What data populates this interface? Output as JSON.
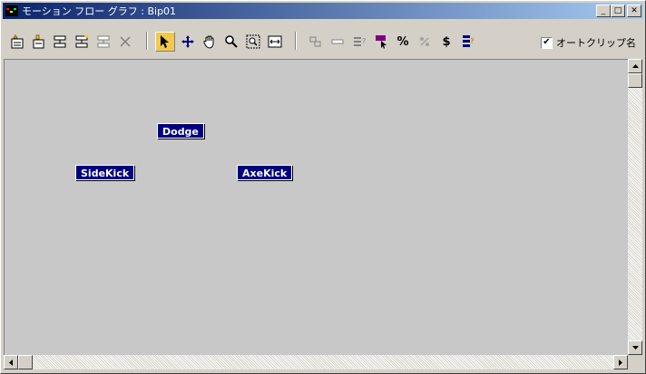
{
  "window": {
    "title": "モーション フロー グラフ : Bip01"
  },
  "title_controls": {
    "minimize": "_",
    "maximize": "□",
    "close": "✕"
  },
  "toolbar": {
    "tools_left": [
      {
        "name": "create-script-icon"
      },
      {
        "name": "open-script-icon"
      },
      {
        "name": "show-graph-icon"
      },
      {
        "name": "add-clip-icon"
      },
      {
        "name": "add-transition-icon"
      },
      {
        "name": "delete-icon"
      }
    ],
    "tools_mid": [
      {
        "name": "select-tool-icon",
        "active": true
      },
      {
        "name": "move-tool-icon"
      },
      {
        "name": "pan-hand-icon"
      },
      {
        "name": "zoom-icon"
      },
      {
        "name": "zoom-region-icon"
      },
      {
        "name": "zoom-extents-icon"
      }
    ],
    "tools_right": [
      {
        "name": "random-path-icon"
      },
      {
        "name": "clip-bar-icon"
      },
      {
        "name": "properties-icon"
      },
      {
        "name": "select-random-start-icon",
        "accent": "#800080"
      },
      {
        "name": "percent-icon",
        "glyph": "%"
      },
      {
        "name": "disabled-percent-icon"
      },
      {
        "name": "dollar-icon",
        "glyph": "$"
      },
      {
        "name": "optimize-icon"
      }
    ],
    "autoclip_label": "オートクリップ名",
    "autoclip_checked": true
  },
  "canvas": {
    "background": "#c8c8c8",
    "nodes": [
      {
        "label": "Dodge"
      },
      {
        "label": "SideKick"
      },
      {
        "label": "AxeKick"
      }
    ]
  },
  "colors": {
    "node_fill": "#000080",
    "title_start": "#0a246a",
    "title_end": "#a6caf0",
    "active_tool": "#f2c94c"
  }
}
